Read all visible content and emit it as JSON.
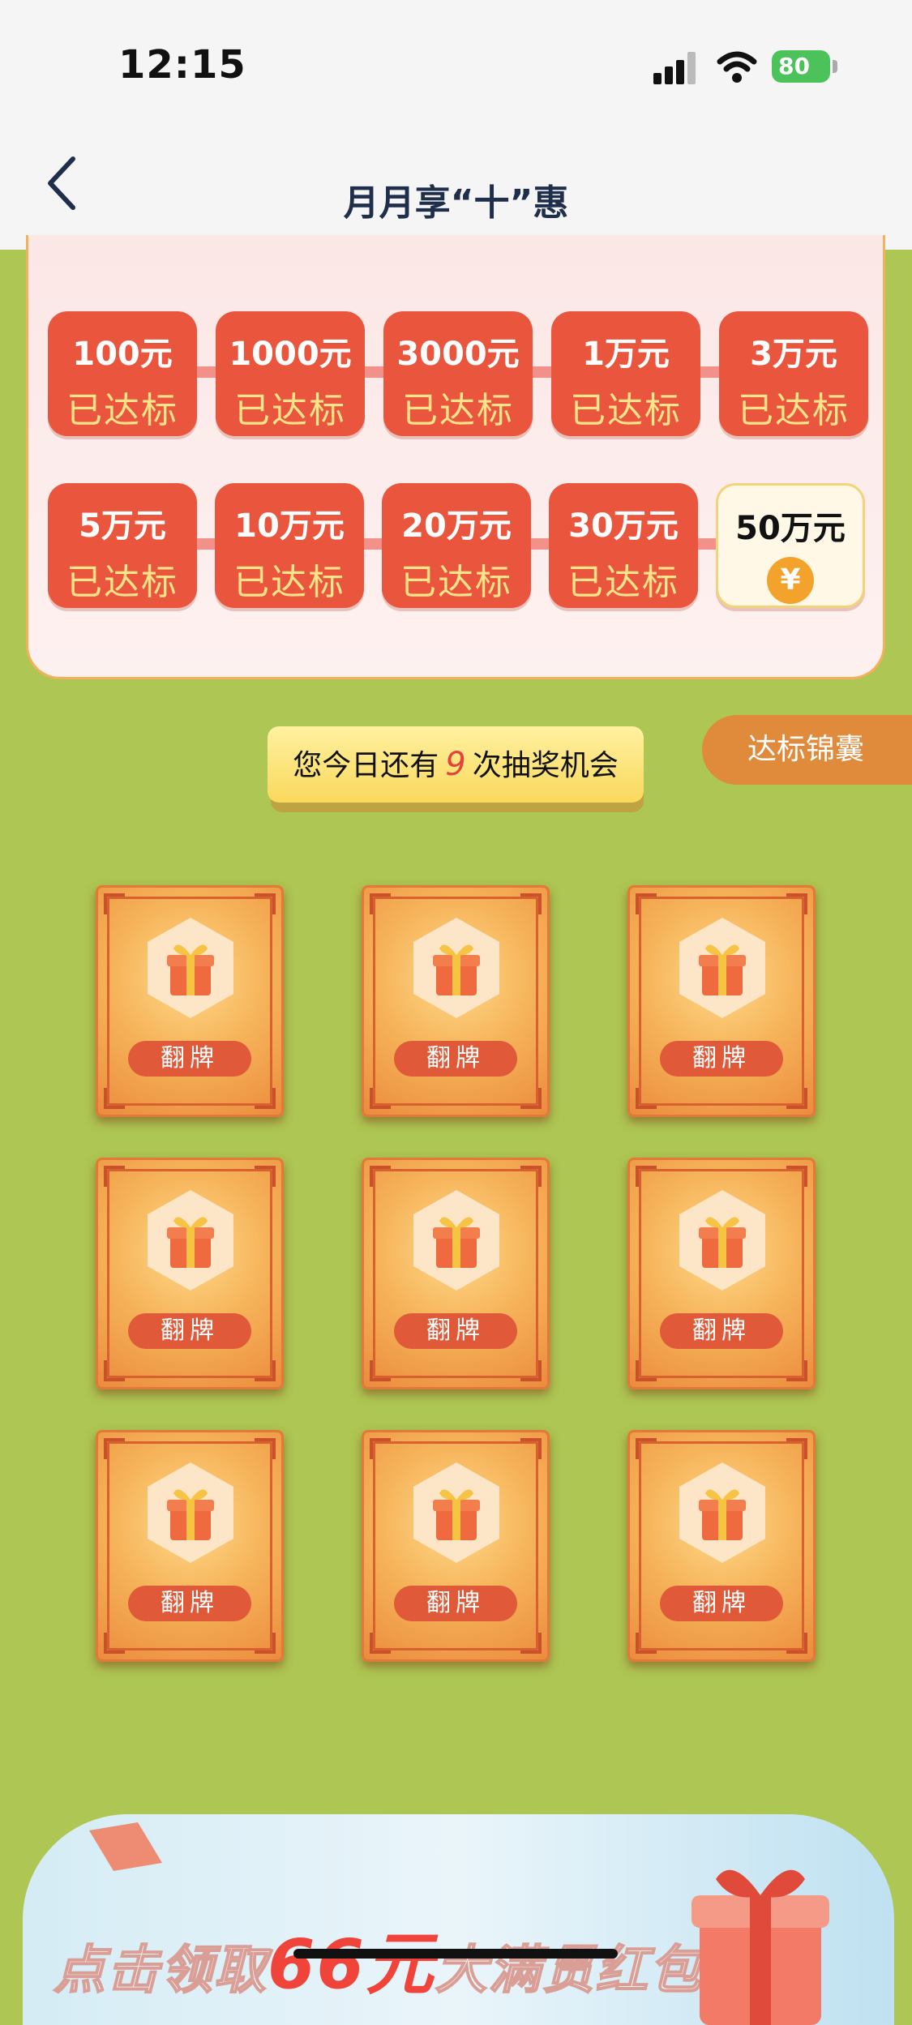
{
  "status_bar": {
    "time": "12:15",
    "battery": "80"
  },
  "nav": {
    "title": "月月享“十”惠"
  },
  "milestones": [
    {
      "amount": "100元",
      "status": "已达标"
    },
    {
      "amount": "1000元",
      "status": "已达标"
    },
    {
      "amount": "3000元",
      "status": "已达标"
    },
    {
      "amount": "1万元",
      "status": "已达标"
    },
    {
      "amount": "3万元",
      "status": "已达标"
    },
    {
      "amount": "5万元",
      "status": "已达标"
    },
    {
      "amount": "10万元",
      "status": "已达标"
    },
    {
      "amount": "20万元",
      "status": "已达标"
    },
    {
      "amount": "30万元",
      "status": "已达标"
    },
    {
      "amount": "50万元",
      "status": "",
      "coin_symbol": "¥"
    }
  ],
  "chances": {
    "prefix": "您今日还有",
    "count": "9",
    "suffix": "次抽奖机会"
  },
  "tips_tab": {
    "label": "达标锦囊"
  },
  "cards": {
    "flip_label": "翻牌",
    "count": 9
  },
  "banner": {
    "text_prefix": "点击领取",
    "text_amount": "66元",
    "text_suffix": "大满贯红包"
  },
  "colors": {
    "page_bg": "#aec653",
    "badge_red": "#e9563d",
    "status_yellow": "#ffe38a",
    "card_orange": "#f6b45a"
  }
}
